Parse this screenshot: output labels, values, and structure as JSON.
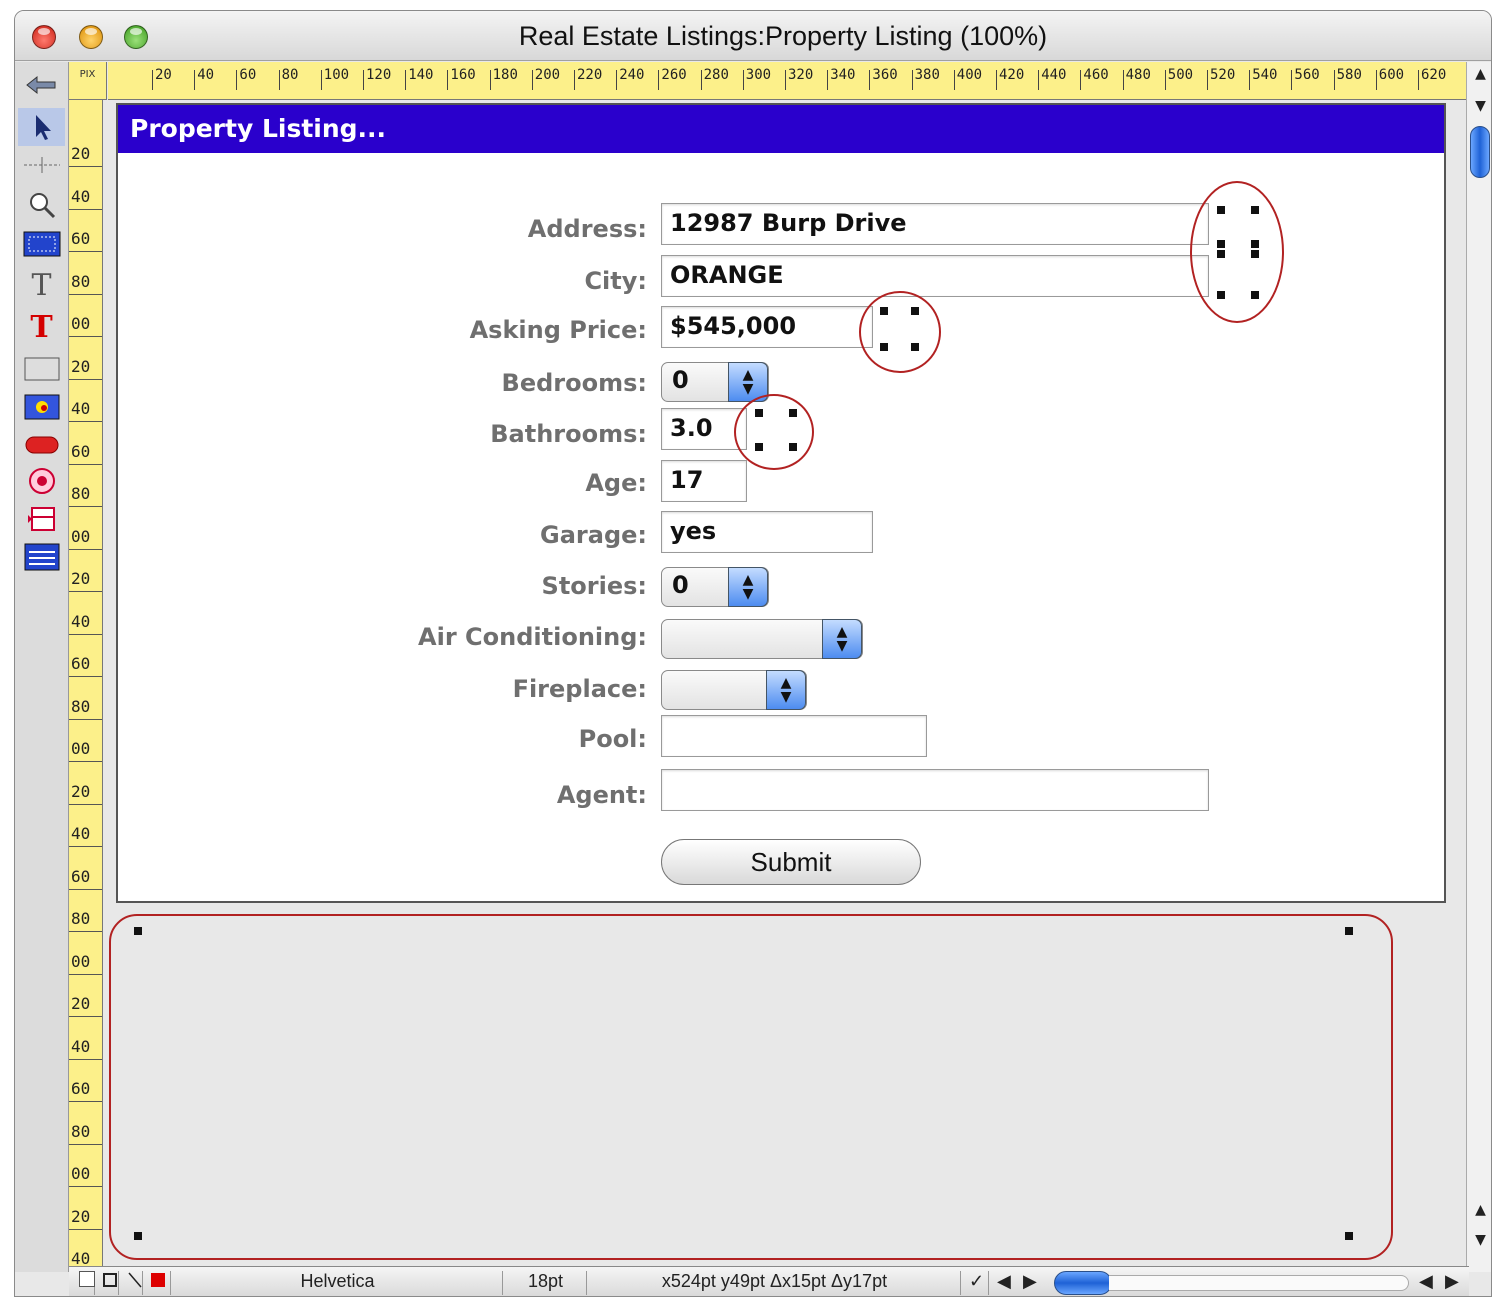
{
  "window": {
    "title": "Real Estate Listings:Property Listing (100%)"
  },
  "ruler": {
    "unit_label": "PIX",
    "top_ticks": [
      "20",
      "40",
      "60",
      "80",
      "100",
      "120",
      "140",
      "160",
      "180",
      "200",
      "220",
      "240",
      "260",
      "280",
      "300",
      "320",
      "340",
      "360",
      "380",
      "400",
      "420",
      "440",
      "460",
      "480",
      "500",
      "520",
      "540",
      "560",
      "580",
      "600",
      "620"
    ],
    "left_ticks": [
      "20",
      "40",
      "60",
      "80",
      "00",
      "20",
      "40",
      "60",
      "80",
      "00",
      "20",
      "40",
      "60",
      "80",
      "00",
      "20",
      "40",
      "60",
      "80",
      "00",
      "20",
      "40",
      "60",
      "80",
      "00",
      "20",
      "40"
    ]
  },
  "palette": {
    "tools": [
      "arrow-tool-icon",
      "crosshair-tool-icon",
      "magnifier-tool-icon",
      "data-cell-tool-icon",
      "text-tool-icon",
      "text-display-tool-icon",
      "rectangle-tool-icon",
      "flash-art-tool-icon",
      "button-tool-icon",
      "radio-button-tool-icon",
      "popup-menu-tool-icon",
      "list-tool-icon"
    ]
  },
  "form": {
    "header": "Property Listing...",
    "fields": [
      {
        "label": "Address:",
        "value": "12987 Burp Drive"
      },
      {
        "label": "City:",
        "value": "ORANGE"
      },
      {
        "label": "Asking Price:",
        "value": "$545,000"
      },
      {
        "label": "Bedrooms:",
        "value": "0"
      },
      {
        "label": "Bathrooms:",
        "value": "3.0"
      },
      {
        "label": "Age:",
        "value": "17"
      },
      {
        "label": "Garage:",
        "value": "yes"
      },
      {
        "label": "Stories:",
        "value": "0"
      },
      {
        "label": "Air Conditioning:",
        "value": ""
      },
      {
        "label": "Fireplace:",
        "value": ""
      },
      {
        "label": "Pool:",
        "value": ""
      },
      {
        "label": "Agent:",
        "value": ""
      }
    ],
    "submit_label": "Submit"
  },
  "status_bar": {
    "font": "Helvetica",
    "size": "18pt",
    "coords": "x524pt y49pt Δx15pt Δy17pt"
  },
  "colors": {
    "header_bg": "#2a00cc",
    "ruler_bg": "#fcf08a",
    "annotation": "#b22222"
  }
}
